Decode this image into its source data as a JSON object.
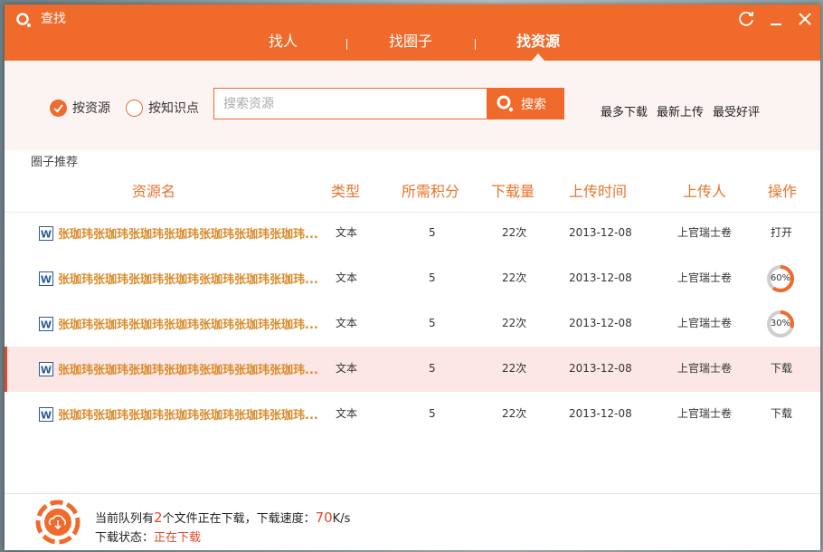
{
  "window": {
    "title": "查找"
  },
  "colors": {
    "accent": "#ef6a2b",
    "highlight_row": "#fde7e6",
    "name_text": "#d98b2a",
    "header_text": "#e8742e",
    "search_bg": "#fbf4f2"
  },
  "nav": {
    "tabs": [
      "找人",
      "找圈子",
      "找资源"
    ],
    "active": "找资源"
  },
  "search": {
    "radio_resource": "按资源",
    "radio_knowledge": "按知识点",
    "selected": "按资源",
    "placeholder": "搜索资源",
    "button": "搜索",
    "sort": [
      "最多下载",
      "最新上传",
      "最受好评"
    ]
  },
  "section": {
    "label": "圈子推荐"
  },
  "table": {
    "headers": [
      "资源名",
      "类型",
      "所需积分",
      "下载量",
      "上传时间",
      "上传人",
      "操作"
    ],
    "rows": [
      {
        "name": "张珈玮张珈玮张珈玮张珈玮张珈玮张珈玮张珈玮...",
        "type": "文本",
        "points": "5",
        "downloads": "22次",
        "date": "2013-12-08",
        "uploader": "上官瑞士卷",
        "action": "打开"
      },
      {
        "name": "张珈玮张珈玮张珈玮张珈玮张珈玮张珈玮张珈玮...",
        "type": "文本",
        "points": "5",
        "downloads": "22次",
        "date": "2013-12-08",
        "uploader": "上官瑞士卷",
        "action": "60%",
        "progress": 0.6
      },
      {
        "name": "张珈玮张珈玮张珈玮张珈玮张珈玮张珈玮张珈玮...",
        "type": "文本",
        "points": "5",
        "downloads": "22次",
        "date": "2013-12-08",
        "uploader": "上官瑞士卷",
        "action": "30%",
        "progress": 0.3
      },
      {
        "name": "张珈玮张珈玮张珈玮张珈玮张珈玮张珈玮张珈玮...",
        "type": "文本",
        "points": "5",
        "downloads": "22次",
        "date": "2013-12-08",
        "uploader": "上官瑞士卷",
        "action": "下载"
      },
      {
        "name": "张珈玮张珈玮张珈玮张珈玮张珈玮张珈玮张珈玮...",
        "type": "文本",
        "points": "5",
        "downloads": "22次",
        "date": "2013-12-08",
        "uploader": "上官瑞士卷",
        "action": "下载"
      }
    ]
  },
  "footer": {
    "queue_prefix": "当前队列有",
    "queue_count": "2",
    "queue_mid": "个文件正在下载，下载速度：",
    "speed": "70",
    "speed_unit": "K/s",
    "status_label": "下载状态：",
    "status_value": "正在下载"
  }
}
